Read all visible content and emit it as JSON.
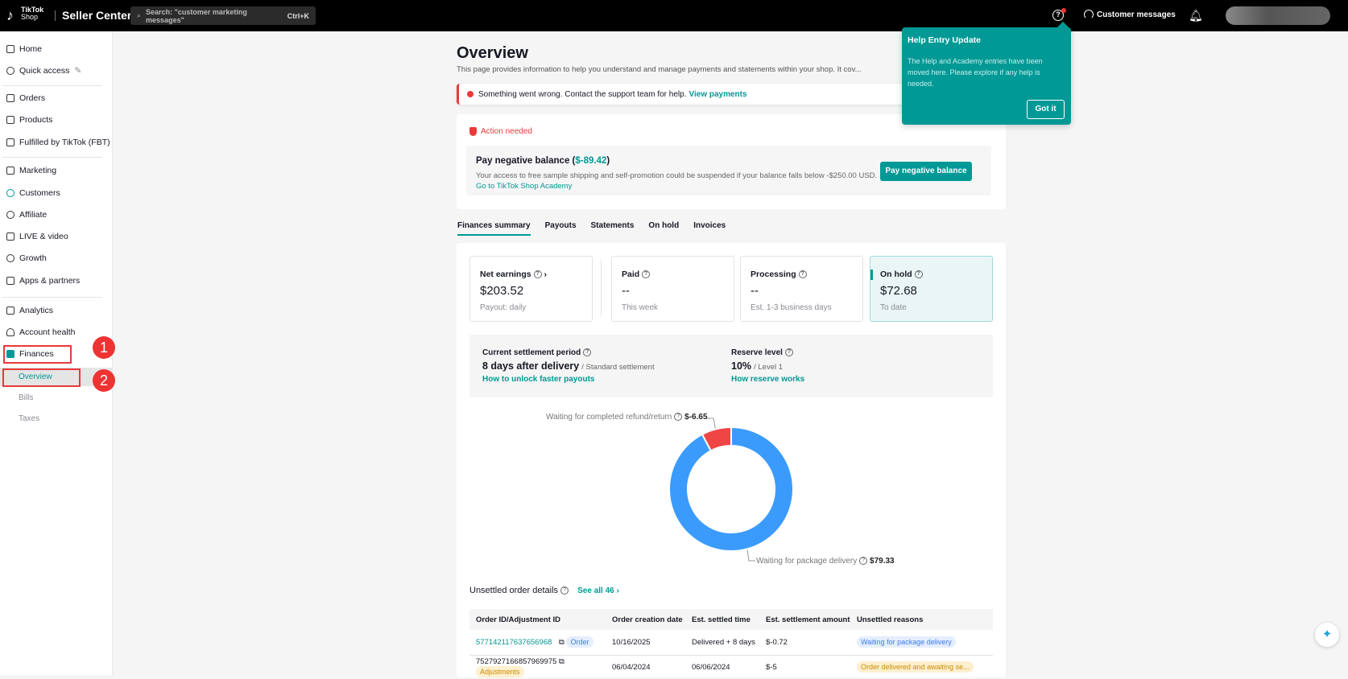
{
  "header": {
    "brand_top": "TikTok",
    "brand_bottom": "Shop",
    "app_title": "Seller Center",
    "search_placeholder": "Search: \"customer marketing messages\"",
    "search_shortcut": "Ctrl+K",
    "customer_messages": "Customer messages"
  },
  "sidebar": {
    "items": [
      {
        "label": "Home"
      },
      {
        "label": "Quick access"
      },
      {
        "label": "Orders"
      },
      {
        "label": "Products"
      },
      {
        "label": "Fulfilled by TikTok (FBT)"
      },
      {
        "label": "Marketing"
      },
      {
        "label": "Customers"
      },
      {
        "label": "Affiliate"
      },
      {
        "label": "LIVE & video"
      },
      {
        "label": "Growth"
      },
      {
        "label": "Apps & partners"
      },
      {
        "label": "Analytics"
      },
      {
        "label": "Account health"
      },
      {
        "label": "Finances"
      }
    ],
    "finances_sub": [
      "Overview",
      "Bills",
      "Taxes"
    ],
    "annotations": [
      "1",
      "2"
    ]
  },
  "page": {
    "title": "Overview",
    "description": "This page provides information to help you understand and manage payments and statements within your shop. It cov...",
    "error": {
      "text": "Something went wrong. Contact the support team for help.",
      "link": "View payments"
    },
    "action": {
      "label": "Action needed",
      "title": "Pay negative balance (",
      "amount": "$-89.42",
      "title_end": ")",
      "desc": "Your access to free sample shipping and self-promotion could be suspended if your balance falls below -$250.00 USD.",
      "link": "Go to TikTok Shop Academy",
      "button": "Pay negative balance"
    },
    "tabs": [
      "Finances summary",
      "Payouts",
      "Statements",
      "On hold",
      "Invoices"
    ],
    "stats": [
      {
        "title": "Net earnings",
        "value": "$203.52",
        "sub": "Payout: daily"
      },
      {
        "title": "Paid",
        "value": "--",
        "sub": "This week"
      },
      {
        "title": "Processing",
        "value": "--",
        "sub": "Est. 1-3 business days"
      },
      {
        "title": "On hold",
        "value": "$72.68",
        "sub": "To date"
      }
    ],
    "settlement": {
      "title": "Current settlement period",
      "value": "8 days after delivery",
      "suffix": "/ Standard settlement",
      "link": "How to unlock faster payouts"
    },
    "reserve": {
      "title": "Reserve level",
      "value": "10%",
      "suffix": "/ Level 1",
      "link": "How reserve works"
    },
    "unsettled": {
      "title": "Unsettled order details",
      "see_all": "See all 46",
      "columns": [
        "Order ID/Adjustment ID",
        "Order creation date",
        "Est. settled time",
        "Est. settlement amount",
        "Unsettled reasons"
      ],
      "rows": [
        {
          "id": "577142117637656968",
          "type": "Order",
          "created": "10/16/2025",
          "settled": "Delivered + 8 days",
          "amount": "$-0.72",
          "reason": "Waiting for package delivery"
        },
        {
          "id": "7527927166857969975",
          "type": "Adjustments",
          "created": "06/04/2024",
          "settled": "06/06/2024",
          "amount": "$-5",
          "reason": "Order delivered and awaiting se..."
        }
      ]
    }
  },
  "tooltip": {
    "title": "Help Entry Update",
    "body": "The Help and Academy entries have been moved here. Please explore if any help is needed.",
    "button": "Got it"
  },
  "chart_data": {
    "type": "pie",
    "donut": true,
    "series": [
      {
        "name": "Waiting for package delivery",
        "value": 79.33,
        "label": "$79.33",
        "color": "#3a9bfd"
      },
      {
        "name": "Waiting for completed refund/return",
        "value": 6.65,
        "label": "$-6.65",
        "color": "#f04545"
      }
    ]
  },
  "colors": {
    "accent": "#009995",
    "error": "#e83a3a"
  }
}
